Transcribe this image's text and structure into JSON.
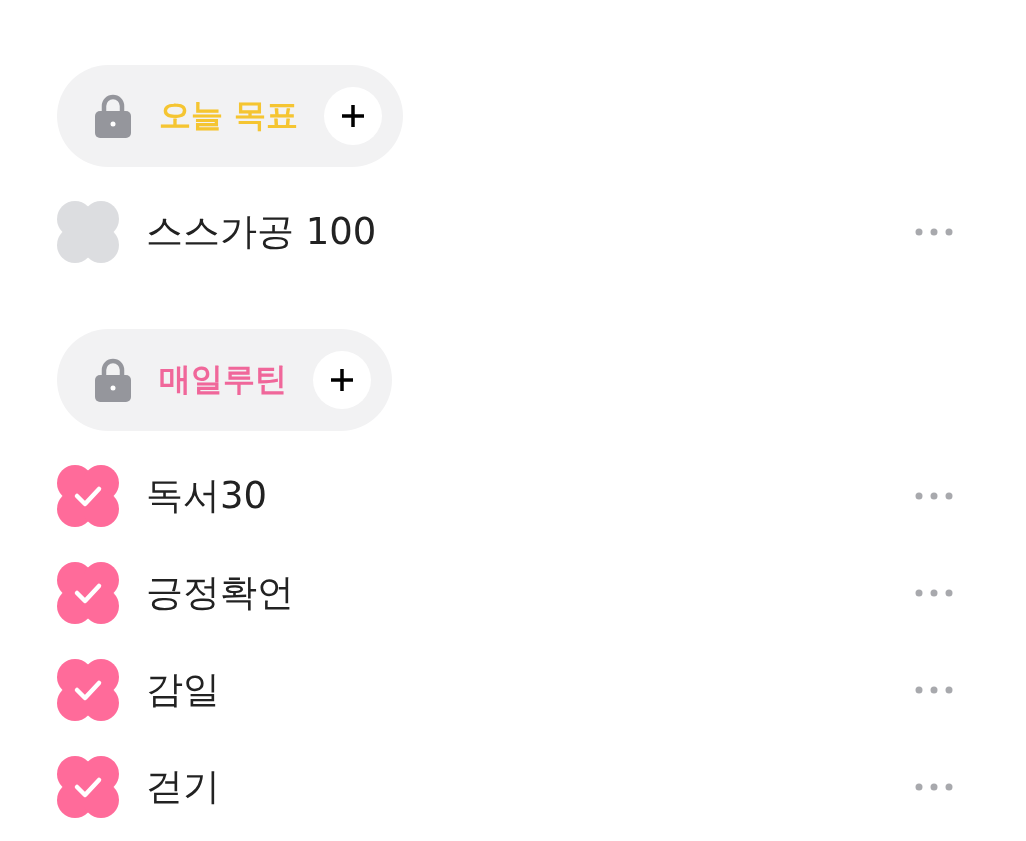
{
  "sections": [
    {
      "title": "오늘 목표",
      "color": "#f5c531",
      "items": [
        {
          "label": "스스가공 100",
          "checked": false
        }
      ]
    },
    {
      "title": "매일루틴",
      "color": "#f0679a",
      "items": [
        {
          "label": "독서30",
          "checked": true
        },
        {
          "label": "긍정확언",
          "checked": true
        },
        {
          "label": "감일",
          "checked": true
        },
        {
          "label": "걷기",
          "checked": true
        }
      ]
    }
  ]
}
